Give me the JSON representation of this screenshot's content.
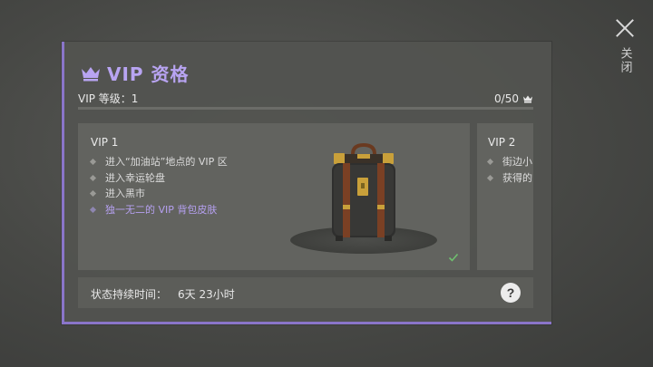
{
  "close": {
    "label": "关闭"
  },
  "panel": {
    "title": "VIP 资格",
    "level_label": "VIP 等级：1",
    "points_label": "0/50",
    "progress_fraction": 0
  },
  "tiers": [
    {
      "title": "VIP 1",
      "perks": [
        "进入“加油站”地点的 VIP 区",
        "进入幸运轮盘",
        "进入黑市",
        "独一无二的 VIP 背包皮肤"
      ],
      "unlocked": true
    },
    {
      "title": "VIP 2",
      "perks": [
        "街边小",
        "获得的"
      ]
    }
  ],
  "status": {
    "label": "状态持续时间：",
    "value": "6天 23小时",
    "help_symbol": "?"
  },
  "colors": {
    "accent": "#8a75c9",
    "title": "#b8a4f2",
    "highlight_perk": "#b5a0f0",
    "check": "#6fbf6f"
  },
  "icons": {
    "title": "crown-icon",
    "points": "crown-icon",
    "close": "close-icon",
    "unlocked": "checkmark-icon",
    "help": "help-icon"
  }
}
